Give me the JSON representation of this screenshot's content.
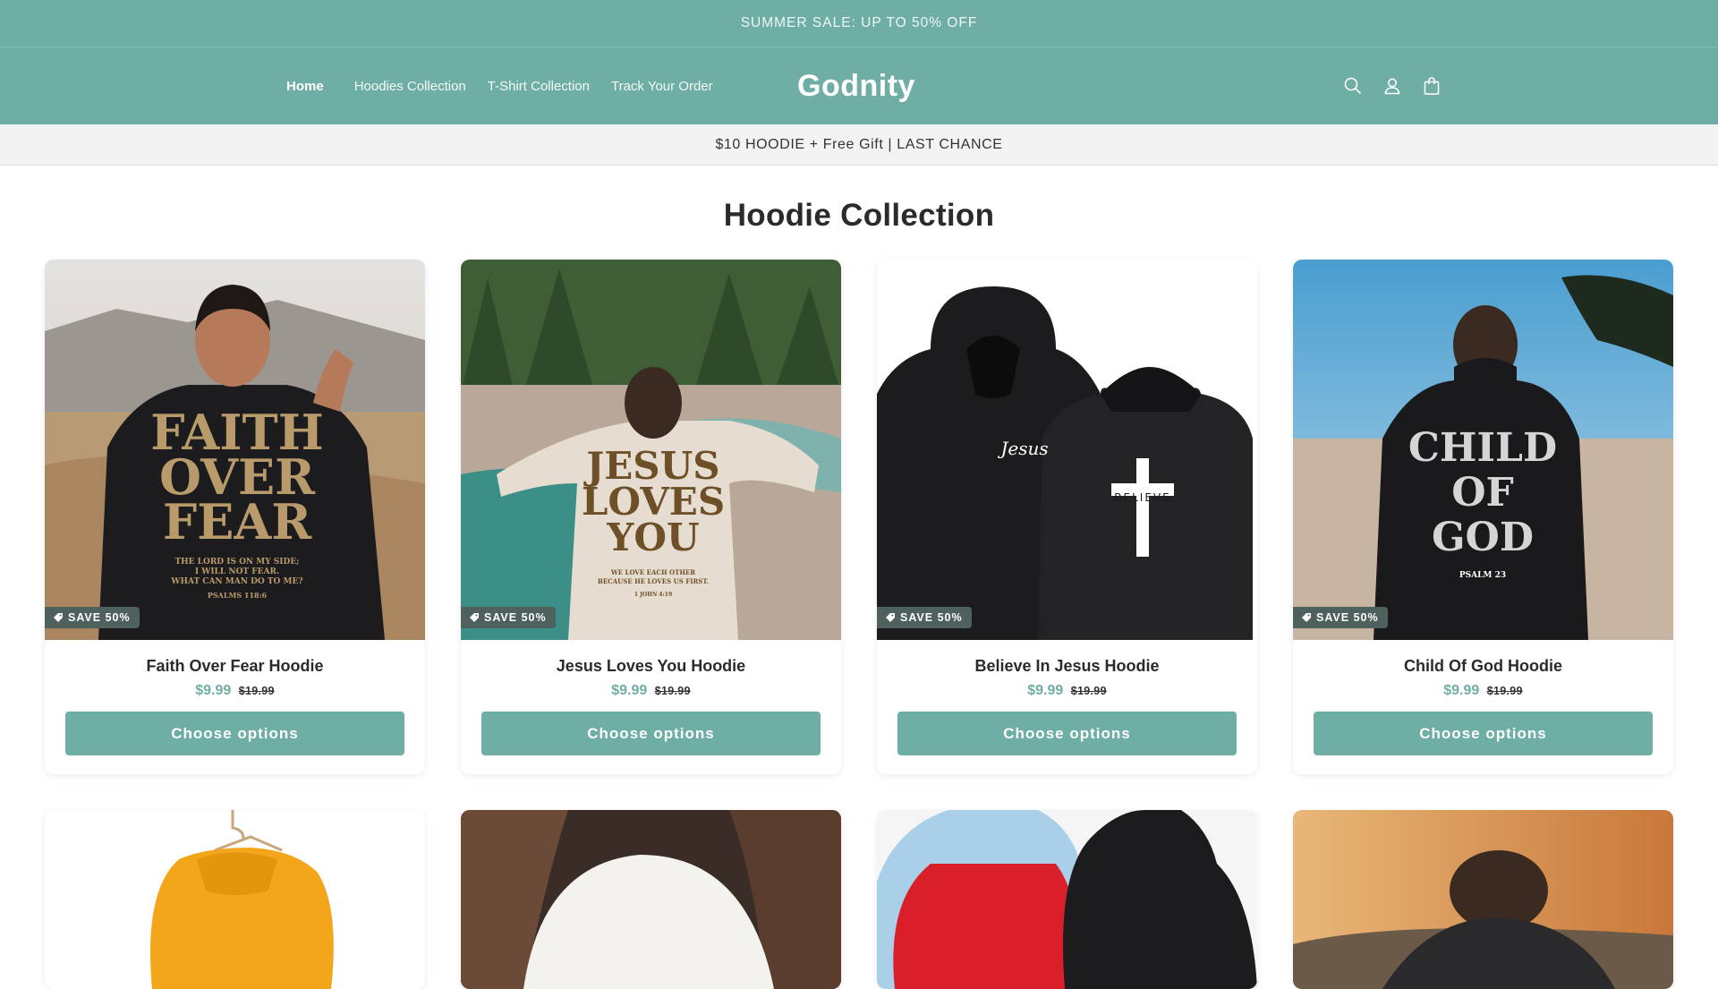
{
  "announcement": "SUMMER SALE: UP TO 50% OFF",
  "nav": {
    "items": [
      "Home",
      "Hoodies Collection",
      "T-Shirt Collection",
      "Track Your Order"
    ]
  },
  "brand": "Godnity",
  "icons": [
    "search-icon",
    "account-icon",
    "cart-icon"
  ],
  "promo": "$10 HOODIE + Free Gift | LAST CHANCE",
  "section_title": "Hoodie Collection",
  "products": [
    {
      "title": "Faith Over Fear Hoodie",
      "badge": "SAVE 50%",
      "price": "$9.99",
      "compare_price": "$19.99",
      "button": "Choose options",
      "print": [
        "FAITH",
        "OVER",
        "FEAR"
      ],
      "print_small": [
        "THE LORD IS ON MY SIDE;",
        "I WILL NOT FEAR.",
        "WHAT CAN MAN DO TO ME?",
        "PSALMS 118:6"
      ]
    },
    {
      "title": "Jesus Loves You Hoodie",
      "badge": "SAVE 50%",
      "price": "$9.99",
      "compare_price": "$19.99",
      "button": "Choose options",
      "print": [
        "JESUS",
        "LOVES",
        "YOU"
      ],
      "print_small": [
        "WE LOVE EACH OTHER",
        "BECAUSE HE LOVES US FIRST.",
        "1 JOHN 4:19"
      ]
    },
    {
      "title": "Believe In Jesus Hoodie",
      "badge": "SAVE 50%",
      "price": "$9.99",
      "compare_price": "$19.99",
      "button": "Choose options",
      "print": [
        "Jesus",
        "BELIEVE"
      ],
      "print_small": []
    },
    {
      "title": "Child Of God Hoodie",
      "badge": "SAVE 50%",
      "price": "$9.99",
      "compare_price": "$19.99",
      "button": "Choose options",
      "print": [
        "CHILD",
        "OF",
        "GOD"
      ],
      "print_small": [
        "PSALM 23"
      ]
    }
  ],
  "colors": {
    "accent": "#6faea4",
    "badge": "#4e615d",
    "hoodie_black": "#1c1c1e",
    "hoodie_cream": "#e6ddd0"
  }
}
